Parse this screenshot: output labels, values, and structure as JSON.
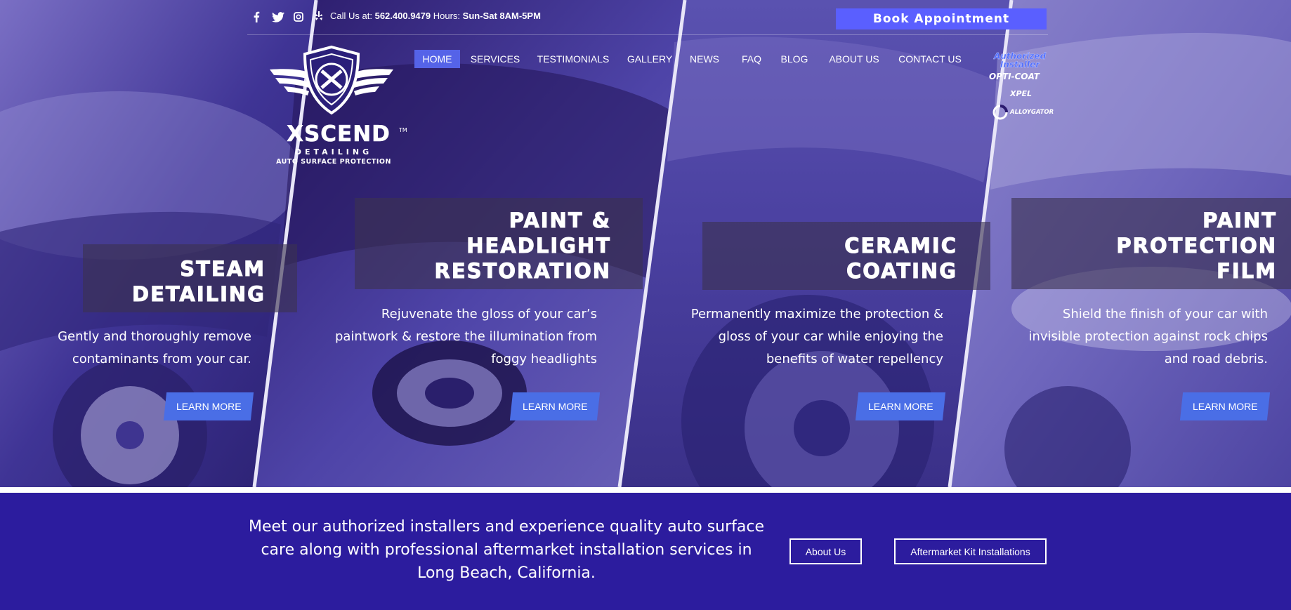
{
  "topbar": {
    "social": [
      {
        "icon": "facebook-icon",
        "glyph": "f"
      },
      {
        "icon": "twitter-icon",
        "glyph": "t"
      },
      {
        "icon": "instagram-icon",
        "glyph": "i"
      },
      {
        "icon": "yelp-icon",
        "glyph": "y"
      }
    ],
    "call_prefix": "Call Us at:",
    "phone": "562.400.9479",
    "hours_prefix": "Hours:",
    "hours": "Sun-Sat 8AM-5PM",
    "book_label": "Book Appointment"
  },
  "logo": {
    "title": "XSCEND",
    "tm": "TM",
    "sub1": "DETAILING",
    "sub2": "AUTO SURFACE PROTECTION"
  },
  "nav": {
    "items": [
      "HOME",
      "SERVICES",
      "TESTIMONIALS",
      "GALLERY",
      "NEWS",
      "FAQ",
      "BLOG",
      "ABOUT US",
      "CONTACT US"
    ],
    "active": "HOME"
  },
  "authorized": {
    "title_line1": "Authorized",
    "title_line2": "Installer",
    "brands": [
      "OPTI-COAT",
      "XPEL",
      "ALLOYGATOR"
    ]
  },
  "services": [
    {
      "title": "STEAM\nDETAILING",
      "description": "Gently and thoroughly remove contaminants from your car.",
      "button": "LEARN MORE"
    },
    {
      "title": "PAINT &\nHEADLIGHT\nRESTORATION",
      "description": "Rejuvenate the gloss of your car’s paintwork & restore the illumination from foggy headlights",
      "button": "LEARN MORE"
    },
    {
      "title": "CERAMIC\nCOATING",
      "description": "Permanently maximize the protection & gloss of your car while enjoying the benefits of water repellency",
      "button": "LEARN MORE"
    },
    {
      "title": "PAINT\nPROTECTION\nFILM",
      "description": "Shield the finish of your car with invisible protection against rock chips and road debris.",
      "button": "LEARN MORE"
    }
  ],
  "band": {
    "text": "Meet our authorized installers and experience quality auto surface care along with professional aftermarket installation services in Long Beach, California.",
    "about_label": "About Us",
    "kit_label": "Aftermarket Kit Installations"
  },
  "colors": {
    "band_bg": "#2c1c9e",
    "accent": "#5a5fff",
    "button": "#4a6ee6",
    "nav_active": "#5563e8"
  }
}
